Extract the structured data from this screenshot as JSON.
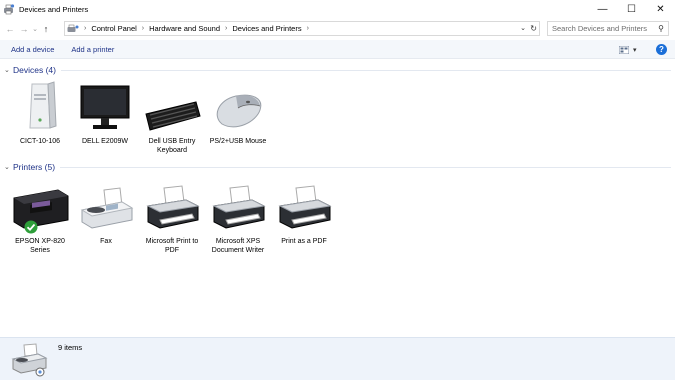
{
  "window": {
    "title": "Devices and Printers",
    "controls": {
      "minimize": "—",
      "maximize": "☐",
      "close": "✕"
    }
  },
  "nav": {
    "back": "←",
    "forward": "→",
    "recent": "⌄",
    "up": "↑",
    "breadcrumbs": [
      "Control Panel",
      "Hardware and Sound",
      "Devices and Printers"
    ],
    "separator": "›",
    "dropdown": "⌄",
    "refresh": "↻",
    "search_placeholder": "Search Devices and Printers",
    "search_icon": "⚲"
  },
  "commands": {
    "add_device": "Add a device",
    "add_printer": "Add a printer",
    "view_caret": "▾",
    "help": "?"
  },
  "devices": {
    "header": "Devices (4)",
    "chevron": "⌄",
    "items": [
      {
        "label": "CICT-10-106",
        "icon": "computer-tower-icon"
      },
      {
        "label": "DELL E2009W",
        "icon": "monitor-icon"
      },
      {
        "label": "Dell USB Entry Keyboard",
        "icon": "keyboard-icon"
      },
      {
        "label": "PS/2+USB Mouse",
        "icon": "mouse-icon"
      }
    ]
  },
  "printers": {
    "header": "Printers (5)",
    "chevron": "⌄",
    "items": [
      {
        "label": "EPSON XP-820 Series",
        "icon": "inkjet-printer-icon",
        "default": true
      },
      {
        "label": "Fax",
        "icon": "fax-icon"
      },
      {
        "label": "Microsoft Print to PDF",
        "icon": "printer-icon"
      },
      {
        "label": "Microsoft XPS Document Writer",
        "icon": "printer-icon"
      },
      {
        "label": "Print as a PDF",
        "icon": "printer-icon"
      }
    ]
  },
  "status": {
    "count": "9 items"
  },
  "colors": {
    "link": "#1e3287",
    "help": "#1a6ed8",
    "check": "#2e9e3a",
    "statusbar": "#eef3fa"
  }
}
